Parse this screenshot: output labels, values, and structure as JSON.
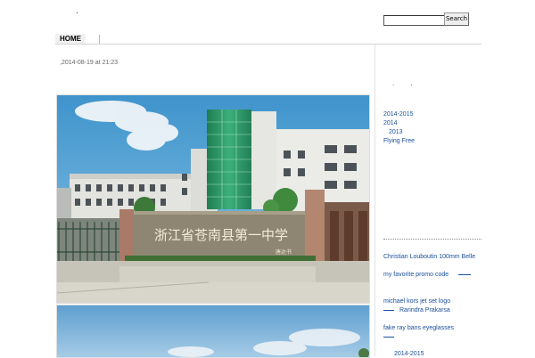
{
  "site": {
    "title_mark": "."
  },
  "search": {
    "value": "",
    "button_label": "Search"
  },
  "nav": {
    "items": [
      {
        "label": "HOME"
      }
    ]
  },
  "post": {
    "date": ",2014-08-19 at 21:23"
  },
  "sidebar": {
    "top_marks": "· ·",
    "archives": [
      "2014-2015",
      "2014",
      "2013",
      "Flying Free"
    ],
    "links": [
      "Christian Louboutin 100mm Belle",
      "my favorite promo code",
      "michael kors jet set logo",
      "Rarindra Prakarsa",
      "fake ray bans eyeglasses",
      "2014-2015"
    ]
  },
  "photo": {
    "gate_sign": "浙江省苍南县第一中学",
    "gate_signature": "唐达书"
  },
  "colors": {
    "link": "#1a4e9c",
    "sky": "#4a9ed0",
    "facade_green": "#2f9a6a",
    "sign_stone": "#8e8672"
  }
}
